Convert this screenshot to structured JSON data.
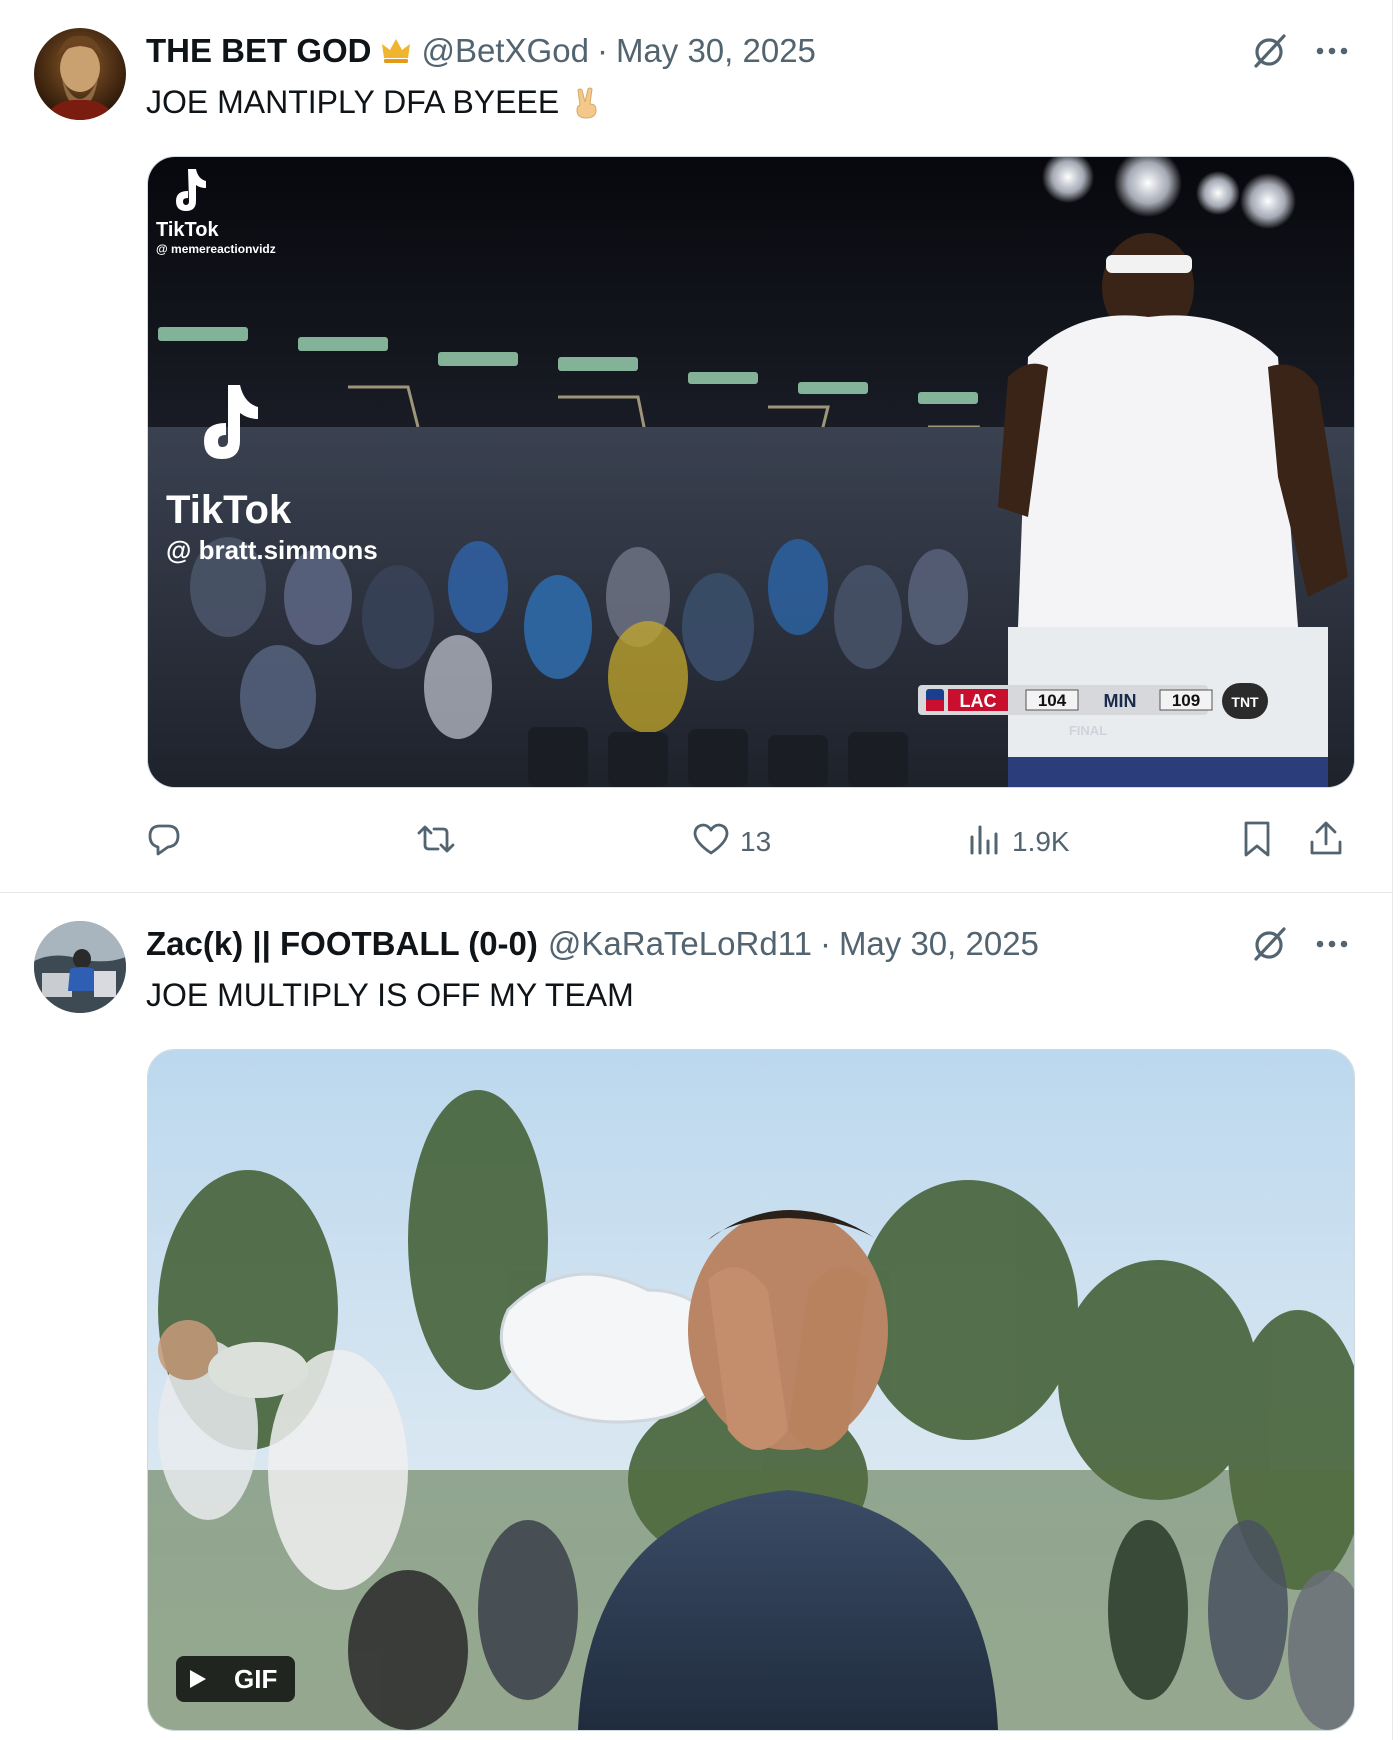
{
  "tweets": [
    {
      "display_name": "THE BET GOD",
      "handle": "@BetXGod",
      "separator": "·",
      "date": "May 30, 2025",
      "text": "JOE MANTIPLY DFA BYEEE",
      "emoji": "✌",
      "badge_icon": "gold-crown-icon",
      "media": {
        "type": "video",
        "tiktok_small_brand": "TikTok",
        "tiktok_small_handle": "@ memereactionvidz",
        "tiktok_large_brand": "TikTok",
        "tiktok_large_handle": "@ bratt.simmons",
        "scoreboard": {
          "away_team": "LAC",
          "away_score": "104",
          "home_team": "MIN",
          "home_score": "109",
          "status": "FINAL",
          "network": "TNT"
        }
      },
      "actions": {
        "reply_count": "",
        "retweet_count": "",
        "like_count": "13",
        "view_count": "1.9K"
      }
    },
    {
      "display_name": "Zac(k) || FOOTBALL (0-0)",
      "handle": "@KaRaTeLoRd11",
      "separator": "·",
      "date": "May 30, 2025",
      "text": "JOE MULTIPLY IS OFF MY TEAM",
      "media": {
        "type": "gif",
        "gif_label": "GIF"
      }
    }
  ],
  "colors": {
    "primary_text": "#0f1419",
    "secondary_text": "#536471",
    "divider": "#e6e9eb"
  }
}
